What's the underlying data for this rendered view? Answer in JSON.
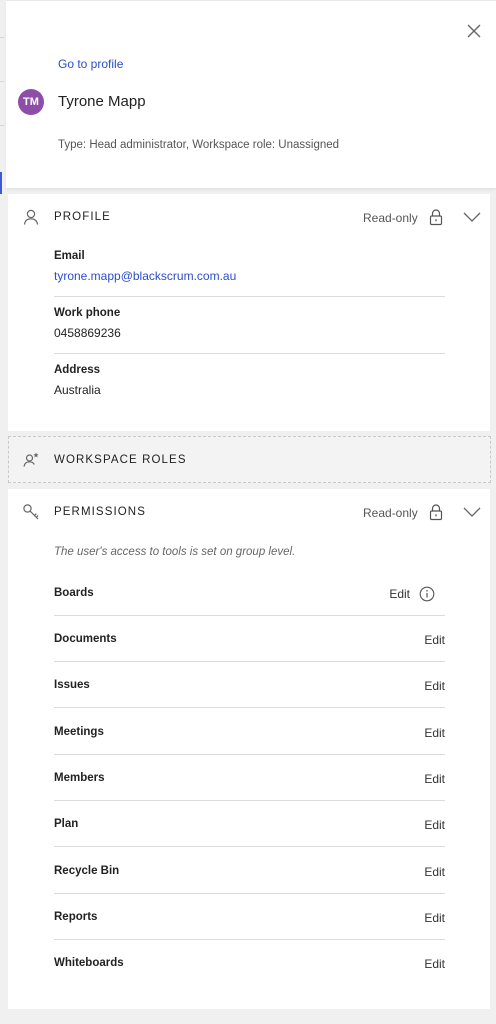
{
  "header": {
    "go_to_profile": "Go to profile",
    "avatar_initials": "TM",
    "user_name": "Tyrone Mapp",
    "user_type": "Type: Head administrator, Workspace role: Unassigned",
    "close_icon": "close-icon"
  },
  "profile": {
    "title": "PROFILE",
    "icon": "person-icon",
    "status": "Read-only",
    "fields": [
      {
        "label": "Email",
        "value": "tyrone.mapp@blackscrum.com.au"
      },
      {
        "label": "Work phone",
        "value": "0458869236"
      },
      {
        "label": "Address",
        "value": "Australia"
      }
    ]
  },
  "workspace_roles": {
    "title": "WORKSPACE ROLES",
    "icon": "person-star-icon"
  },
  "permissions": {
    "title": "PERMISSIONS",
    "icon": "key-icon",
    "status": "Read-only",
    "note": "The user's access to tools is set on group level.",
    "rows": [
      {
        "tool": "Boards",
        "access": "Edit"
      },
      {
        "tool": "Documents",
        "access": "Edit"
      },
      {
        "tool": "Issues",
        "access": "Edit"
      },
      {
        "tool": "Meetings",
        "access": "Edit"
      },
      {
        "tool": "Members",
        "access": "Edit"
      },
      {
        "tool": "Plan",
        "access": "Edit"
      },
      {
        "tool": "Recycle Bin",
        "access": "Edit"
      },
      {
        "tool": "Reports",
        "access": "Edit"
      },
      {
        "tool": "Whiteboards",
        "access": "Edit"
      }
    ]
  },
  "colors": {
    "link": "#2c4ec9",
    "avatar_bg": "#8e4ea8",
    "panel_bg": "#f0f0f0"
  }
}
